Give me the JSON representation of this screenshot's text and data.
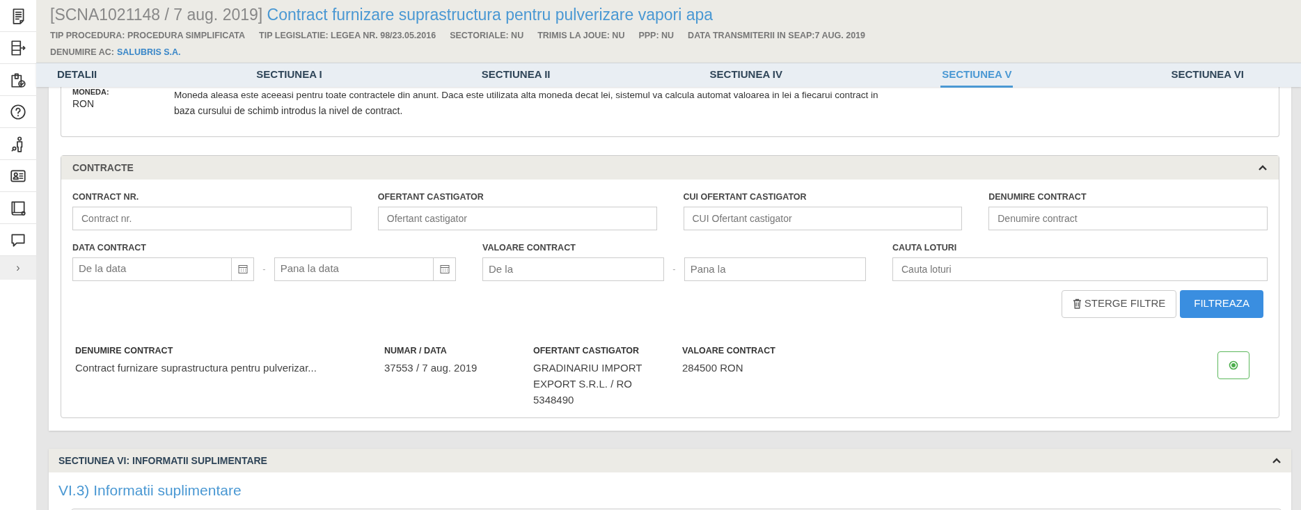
{
  "header": {
    "code": "[SCNA1021148 / 7 aug. 2019]",
    "title": "Contract furnizare suprastructura pentru pulverizare vapori apa",
    "meta": [
      "TIP PROCEDURA: PROCEDURA SIMPLIFICATA",
      "TIP LEGISLATIE: LEGEA NR. 98/23.05.2016",
      "SECTORIALE: NU",
      "TRIMIS LA JOUE: NU",
      "PPP: NU",
      "DATA TRANSMITERII IN SEAP:7 AUG. 2019"
    ],
    "authority_label": "DENUMIRE AC:",
    "authority": "SALUBRIS S.A."
  },
  "sidebar": {
    "items": [
      {
        "kind": "document"
      },
      {
        "kind": "export"
      },
      {
        "kind": "clipboard"
      },
      {
        "kind": "help"
      },
      {
        "kind": "person"
      },
      {
        "kind": "contact"
      },
      {
        "kind": "register"
      },
      {
        "kind": "chat"
      }
    ],
    "expand": "›"
  },
  "tabs": [
    {
      "label": "DETALII",
      "selected": false
    },
    {
      "label": "SECTIUNEA I",
      "selected": false
    },
    {
      "label": "SECTIUNEA II",
      "selected": false
    },
    {
      "label": "SECTIUNEA IV",
      "selected": false
    },
    {
      "label": "SECTIUNEA V",
      "selected": true
    },
    {
      "label": "SECTIUNEA VI",
      "selected": false
    }
  ],
  "currency": {
    "label": "MONEDA:",
    "value": "RON",
    "note_line_1": "Moneda aleasa este aceeasi pentru toate contractele din anunt. Daca este utilizata alta moneda decat lei, sistemul va calcula automat valoarea in lei a fiecarui contract in",
    "note_line_2": "baza cursului de schimb introdus la nivel de contract."
  },
  "contracts": {
    "title": "CONTRACTE",
    "expanded": true,
    "filters_row_1": [
      {
        "label": "CONTRACT NR.",
        "placeholder": "Contract nr."
      },
      {
        "label": "OFERTANT CASTIGATOR",
        "placeholder": "Ofertant castigator"
      },
      {
        "label": "CUI OFERTANT CASTIGATOR",
        "placeholder": "CUI Ofertant castigator"
      },
      {
        "label": "DENUMIRE CONTRACT",
        "placeholder": "Denumire contract"
      }
    ],
    "date_filter": {
      "label": "DATA CONTRACT",
      "from_placeholder": "De la data",
      "separator": "-",
      "to_placeholder": "Pana la data"
    },
    "value_filter": {
      "label": "VALOARE CONTRACT",
      "from_placeholder": "De la",
      "separator": "-",
      "to_placeholder": "Pana la"
    },
    "lot_filter": {
      "label": "CAUTA LOTURI",
      "placeholder": "Cauta loturi"
    },
    "buttons": {
      "clear": "STERGE FILTRE",
      "filter": "FILTREAZA"
    },
    "columns": [
      "DENUMIRE CONTRACT",
      "NUMAR / DATA",
      "OFERTANT CASTIGATOR",
      "VALOARE CONTRACT"
    ],
    "rows": [
      [
        "Contract furnizare suprastructura pentru pulverizar...",
        "37553 / 7 aug. 2019",
        "GRADINARIU IMPORT EXPORT S.R.L. / RO 5348490",
        "284500 RON"
      ]
    ]
  },
  "section_vi": {
    "title": "SECTIUNEA VI: INFORMATII SUPLIMENTARE",
    "expanded": true,
    "subtitle": "VI.3) Informatii suplimentare"
  }
}
